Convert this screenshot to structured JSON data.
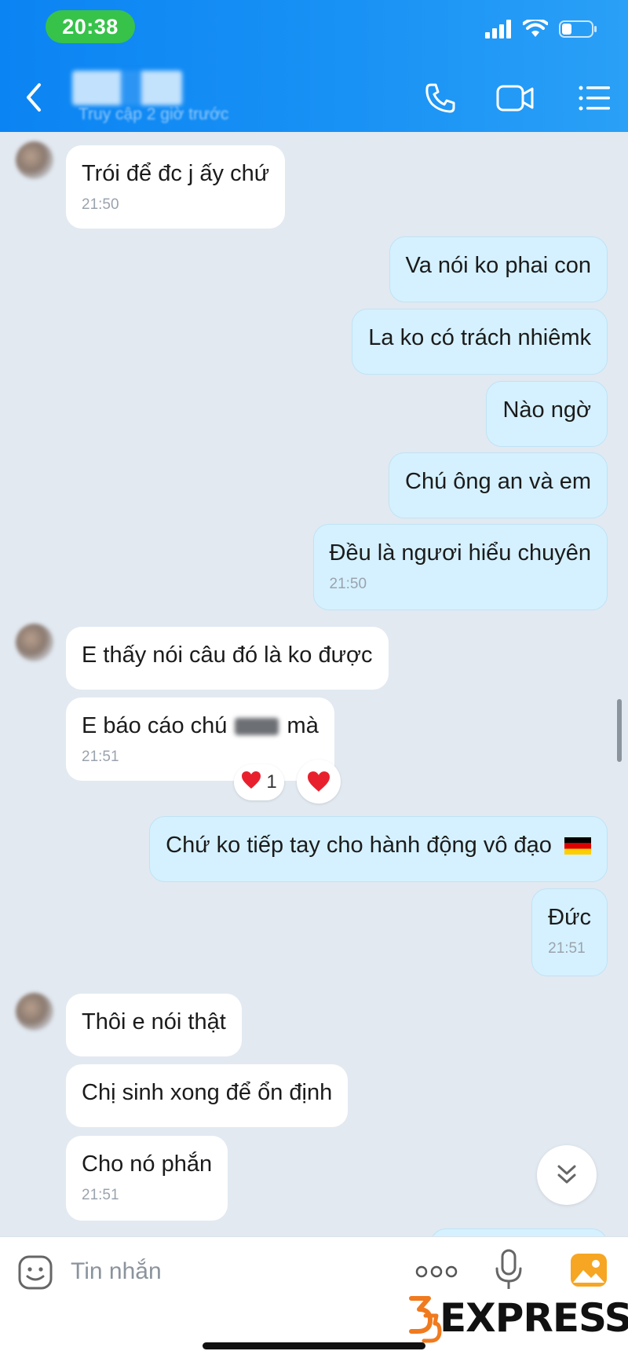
{
  "status_bar": {
    "time": "20:38",
    "icons": [
      "signal-icon",
      "wifi-icon",
      "battery-icon"
    ]
  },
  "header": {
    "contact_name": "",
    "last_seen": "Truy cập 2 giờ trước",
    "actions": [
      "phone-call-icon",
      "video-call-icon",
      "menu-list-icon"
    ]
  },
  "messages": [
    {
      "side": "in",
      "text": "Trói để đc j ấy chứ",
      "time": "21:50"
    },
    {
      "side": "out",
      "text": "Va nói ko phai con"
    },
    {
      "side": "out",
      "text": "La ko có trách nhiêmk"
    },
    {
      "side": "out",
      "text": "Nào ngờ"
    },
    {
      "side": "out",
      "text": "Chú ông an và em"
    },
    {
      "side": "out",
      "text": "Đều là ngươi hiểu chuyên",
      "time": "21:50"
    },
    {
      "side": "in",
      "text": "E thấy nói câu đó là ko được"
    },
    {
      "side": "in",
      "text_before": "E báo cáo chú",
      "text_after": "mà",
      "time": "21:51",
      "reaction_count": "1"
    },
    {
      "side": "out",
      "text": "Chứ ko tiếp tay cho hành động vô đạo",
      "emoji": "germany-flag"
    },
    {
      "side": "out",
      "text": "Đức",
      "time": "21:51"
    },
    {
      "side": "in",
      "text": "Thôi e nói thật"
    },
    {
      "side": "in",
      "text": "Chị sinh xong để ổn định"
    },
    {
      "side": "in",
      "text": "Cho nó phắn",
      "time": "21:51"
    }
  ],
  "input_bar": {
    "placeholder": "Tin nhắn",
    "icons": [
      "emoji-icon",
      "more-icon",
      "microphone-icon",
      "image-icon"
    ]
  },
  "watermark": {
    "number": "35",
    "text": "EXPRESS"
  },
  "colors": {
    "header": "#1a8ff5",
    "status_pill": "#37c24a",
    "chat_bg": "#e2e9f1",
    "outgoing_bubble": "#d5f1ff",
    "incoming_bubble": "#ffffff",
    "heart": "#e8202e"
  }
}
